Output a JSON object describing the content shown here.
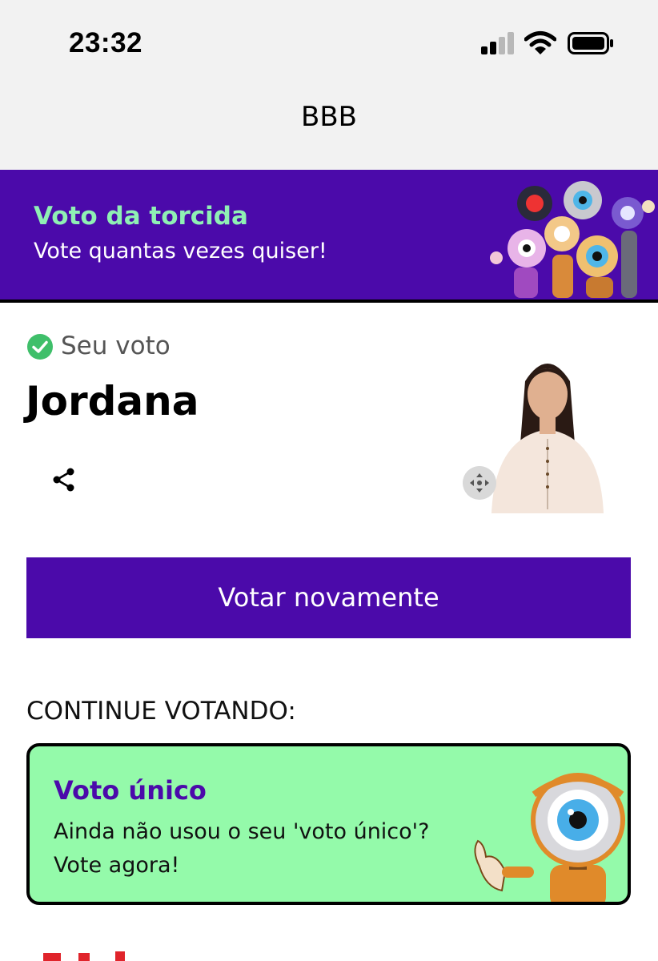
{
  "status_bar": {
    "time": "23:32"
  },
  "nav": {
    "title": "BBB"
  },
  "banner": {
    "title": "Voto da torcida",
    "subtitle": "Vote quantas vezes quiser!"
  },
  "vote": {
    "status_label": "Seu voto",
    "candidate_name": "Jordana"
  },
  "buttons": {
    "vote_again": "Votar novamente"
  },
  "continue_section": {
    "heading": "CONTINUE VOTANDO:",
    "card": {
      "title": "Voto único",
      "line1": "Ainda não usou o seu 'voto único'?",
      "line2": "Vote agora!"
    }
  },
  "colors": {
    "brand_purple": "#4b0aaa",
    "mint_green": "#94faaa",
    "banner_title_green": "#8ff0b4",
    "check_green": "#3fbf6a"
  },
  "icons": [
    "signal-icon",
    "wifi-icon",
    "battery-icon",
    "check-circle-icon",
    "share-icon",
    "move-icon"
  ]
}
